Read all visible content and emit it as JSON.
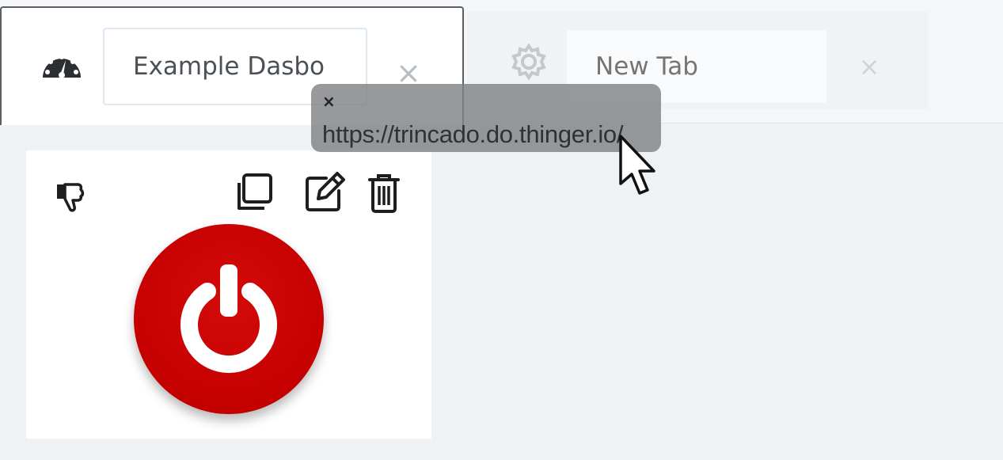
{
  "tabs": [
    {
      "label": "Example Dasbo",
      "icon": "dashboard-gauge-icon",
      "active": true
    },
    {
      "placeholder": "New Tab",
      "icon": "gear-icon",
      "active": false
    }
  ],
  "tooltip": {
    "url": "https://trincado.do.thinger.io/",
    "close_glyph": "×"
  },
  "tab_close_glyph": "×",
  "widget": {
    "icons": [
      "thumbs-down-icon",
      "copy-icon",
      "edit-icon",
      "trash-icon"
    ],
    "power_button": {
      "icon": "power-icon",
      "color": "#c80000"
    }
  },
  "colors": {
    "background": "#eef2f5",
    "tab_active_border": "#5a6066",
    "tooltip_bg": "#808285",
    "power_red": "#c80000"
  }
}
